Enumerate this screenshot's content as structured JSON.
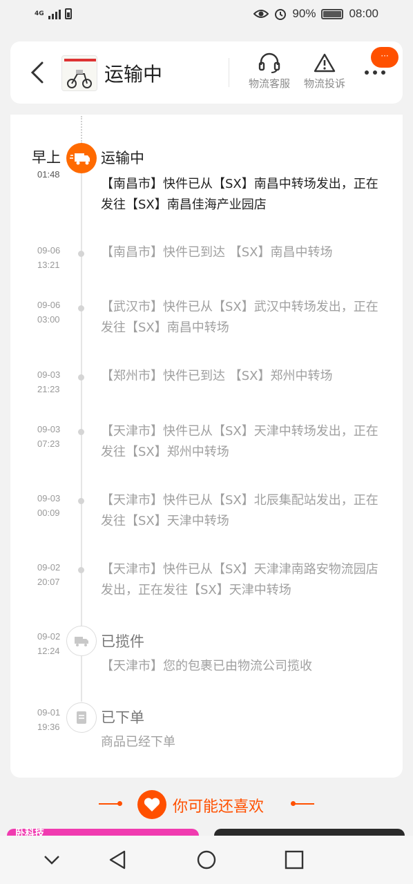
{
  "status_bar": {
    "network": "4G",
    "battery_percent": "90%",
    "time": "08:00"
  },
  "header": {
    "title": "运输中",
    "actions": [
      {
        "label": "物流客服",
        "icon": "headset-icon"
      },
      {
        "label": "物流投诉",
        "icon": "warning-icon"
      }
    ],
    "more_badge": "···"
  },
  "timeline": {
    "current": {
      "date_top": "早上",
      "date_bottom": "01:48",
      "status": "运输中",
      "description": "【南昌市】快件已从【SX】南昌中转场发出，正在发往【SX】南昌佳海产业园店"
    },
    "events": [
      {
        "date": "09-06",
        "time": "13:21",
        "description": "【南昌市】快件已到达 【SX】南昌中转场"
      },
      {
        "date": "09-06",
        "time": "03:00",
        "description": "【武汉市】快件已从【SX】武汉中转场发出，正在发往【SX】南昌中转场"
      },
      {
        "date": "09-03",
        "time": "21:23",
        "description": "【郑州市】快件已到达 【SX】郑州中转场"
      },
      {
        "date": "09-03",
        "time": "07:23",
        "description": "【天津市】快件已从【SX】天津中转场发出，正在发往【SX】郑州中转场"
      },
      {
        "date": "09-03",
        "time": "00:09",
        "description": "【天津市】快件已从【SX】北辰集配站发出，正在发往【SX】天津中转场"
      },
      {
        "date": "09-02",
        "time": "20:07",
        "description": "【天津市】快件已从【SX】天津津南路安物流园店发出，正在发往【SX】天津中转场"
      }
    ],
    "pickup": {
      "date": "09-02",
      "time": "12:24",
      "status": "已揽件",
      "description": "【天津市】您的包裹已由物流公司揽收"
    },
    "ordered": {
      "date": "09-01",
      "time": "19:36",
      "status": "已下单",
      "description": "商品已经下单"
    }
  },
  "recommend": {
    "title": "你可能还喜欢",
    "left_card_text": "卧科技"
  },
  "colors": {
    "accent": "#ff5000",
    "truck_circle": "#ff6a00"
  }
}
